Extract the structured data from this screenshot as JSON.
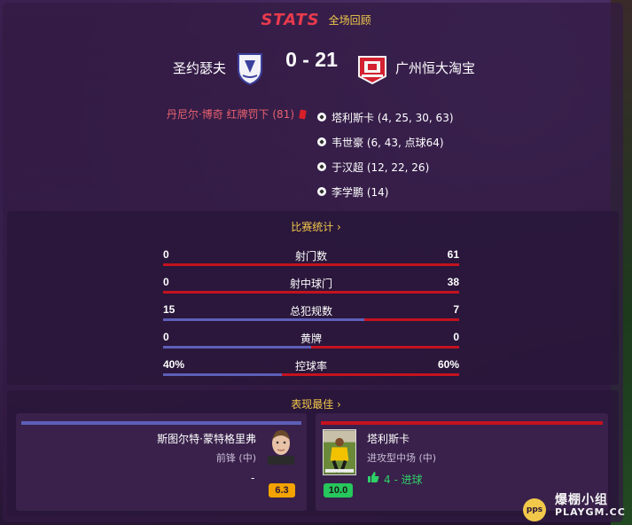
{
  "header": {
    "logo_text": "STATS",
    "subtitle": "全场回顾"
  },
  "match": {
    "home_team": "圣约瑟夫",
    "away_team": "广州恒大淘宝",
    "score": "0 - 21",
    "home_color": "#5d5fb8",
    "away_color": "#c4121f"
  },
  "events": {
    "home": [
      {
        "text": "丹尼尔·博奇 红牌罚下 (81)",
        "icon": "red-card-icon"
      }
    ],
    "away_scorers": [
      {
        "text": "塔利斯卡 (4, 25, 30, 63)",
        "icon": "football-icon"
      },
      {
        "text": "韦世豪 (6, 43, 点球64)",
        "icon": "football-icon"
      },
      {
        "text": "于汉超 (12, 22, 26)",
        "icon": "football-icon"
      },
      {
        "text": "李学鹏 (14)",
        "icon": "football-icon"
      }
    ]
  },
  "match_stats": {
    "title": "比赛统计 ›",
    "rows": [
      {
        "label": "射门数",
        "home": "0",
        "away": "61",
        "home_share": 0.0
      },
      {
        "label": "射中球门",
        "home": "0",
        "away": "38",
        "home_share": 0.0
      },
      {
        "label": "总犯规数",
        "home": "15",
        "away": "7",
        "home_share": 0.68
      },
      {
        "label": "黄牌",
        "home": "0",
        "away": "0",
        "home_share": 0.5
      },
      {
        "label": "控球率",
        "home": "40%",
        "away": "60%",
        "home_share": 0.4
      }
    ]
  },
  "best_players": {
    "title": "表现最佳 ›",
    "home": {
      "name": "斯图尔特·蒙特格里弗",
      "position": "前锋 (中)",
      "contribution": "-",
      "rating": "6.3"
    },
    "away": {
      "name": "塔利斯卡",
      "position": "进攻型中场 (中)",
      "contribution": "4 - 进球",
      "rating": "10.0"
    }
  },
  "watermark": {
    "cn": "爆棚小组",
    "en": "PLAYGM.CC",
    "badge": "pps"
  }
}
